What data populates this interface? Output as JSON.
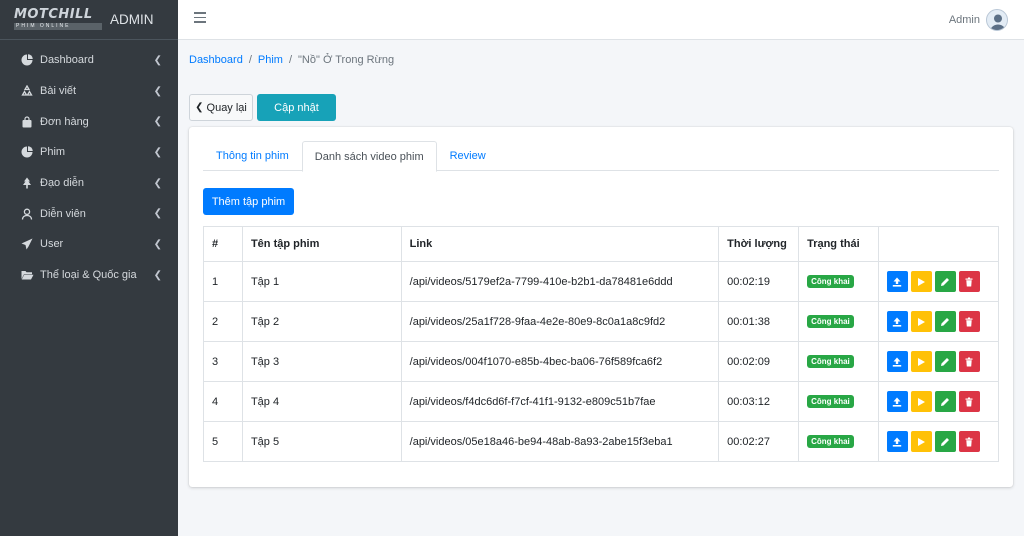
{
  "brand": {
    "logo": "MOTCHILL",
    "logo_sub": "PHIM ONLINE",
    "title": "ADMIN"
  },
  "sidebar": {
    "items": [
      {
        "label": "Dashboard",
        "icon": "pie-chart-icon"
      },
      {
        "label": "Bài viết",
        "icon": "recycle-icon"
      },
      {
        "label": "Đơn hàng",
        "icon": "shopping-bag-icon"
      },
      {
        "label": "Phim",
        "icon": "pie-chart-icon"
      },
      {
        "label": "Đạo diễn",
        "icon": "tree-icon"
      },
      {
        "label": "Diễn viên",
        "icon": "user-icon"
      },
      {
        "label": "User",
        "icon": "send-icon"
      },
      {
        "label": "Thể loại & Quốc gia",
        "icon": "folder-open-icon"
      }
    ]
  },
  "header": {
    "user": "Admin"
  },
  "breadcrumb": {
    "home": "Dashboard",
    "section": "Phim",
    "current": "\"Nồ\" Ở Trong Rừng"
  },
  "buttons": {
    "back": "Quay lại",
    "update": "Cập nhật",
    "add_episode": "Thêm tập phim"
  },
  "tabs": [
    "Thông tin phim",
    "Danh sách video phim",
    "Review"
  ],
  "table": {
    "headers": [
      "#",
      "Tên tập phim",
      "Link",
      "Thời lượng",
      "Trạng thái",
      ""
    ],
    "rows": [
      {
        "num": "1",
        "name": "Tập 1",
        "link": "/api/videos/5179ef2a-7799-410e-b2b1-da78481e6ddd",
        "duration": "00:02:19",
        "status": "Công khai"
      },
      {
        "num": "2",
        "name": "Tập 2",
        "link": "/api/videos/25a1f728-9faa-4e2e-80e9-8c0a1a8c9fd2",
        "duration": "00:01:38",
        "status": "Công khai"
      },
      {
        "num": "3",
        "name": "Tập 3",
        "link": "/api/videos/004f1070-e85b-4bec-ba06-76f589fca6f2",
        "duration": "00:02:09",
        "status": "Công khai"
      },
      {
        "num": "4",
        "name": "Tập 4",
        "link": "/api/videos/f4dc6d6f-f7cf-41f1-9132-e809c51b7fae",
        "duration": "00:03:12",
        "status": "Công khai"
      },
      {
        "num": "5",
        "name": "Tập 5",
        "link": "/api/videos/05e18a46-be94-48ab-8a93-2abe15f3eba1",
        "duration": "00:02:27",
        "status": "Công khai"
      }
    ]
  },
  "colors": {
    "sidebar": "#343a40",
    "primary": "#007bff",
    "info": "#17a2b8",
    "success": "#28a745",
    "warning": "#ffc107",
    "danger": "#dc3545"
  }
}
